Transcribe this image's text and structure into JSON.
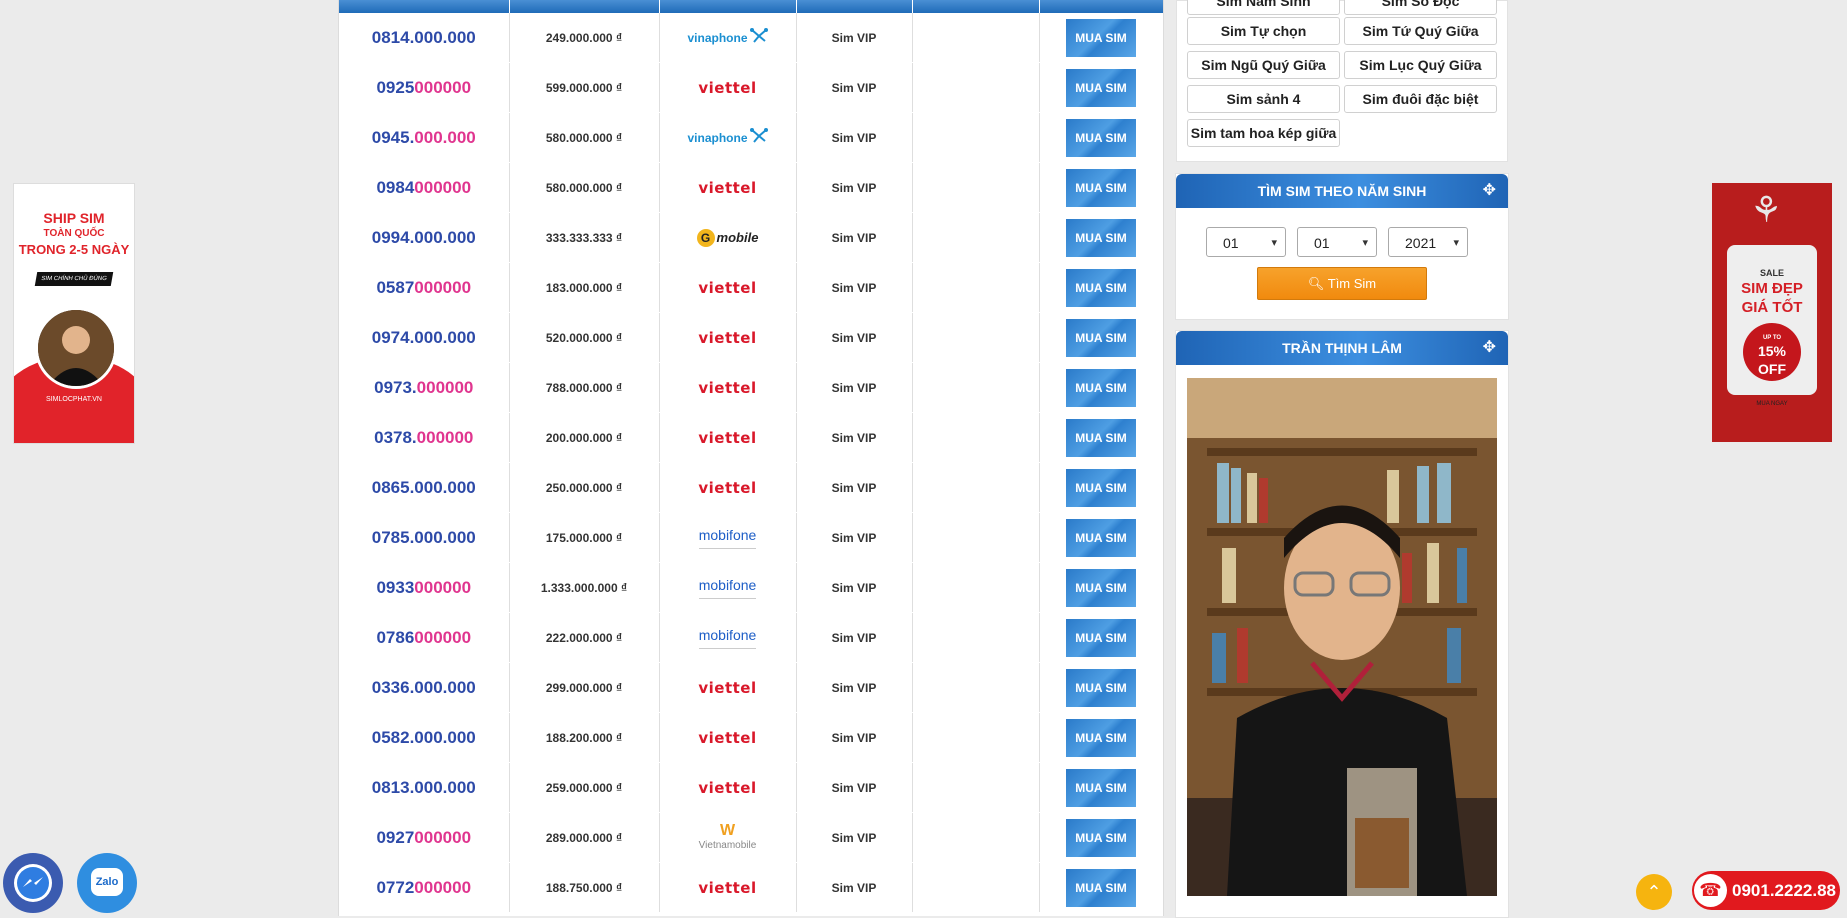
{
  "sims": [
    {
      "num_head": "0814.000.000",
      "num_tail": "",
      "price": "249.000.000 ₫",
      "network": "vinaphone",
      "type": "Sim VIP",
      "buy": "MUA SIM"
    },
    {
      "num_head": "0925",
      "num_tail": "000000",
      "price": "599.000.000 ₫",
      "network": "viettel",
      "type": "Sim VIP",
      "buy": "MUA SIM"
    },
    {
      "num_head": "0945.",
      "num_tail": "000.000",
      "price": "580.000.000 ₫",
      "network": "vinaphone",
      "type": "Sim VIP",
      "buy": "MUA SIM"
    },
    {
      "num_head": "0984",
      "num_tail": "000000",
      "price": "580.000.000 ₫",
      "network": "viettel",
      "type": "Sim VIP",
      "buy": "MUA SIM"
    },
    {
      "num_head": "0994.000.000",
      "num_tail": "",
      "price": "333.333.333 ₫",
      "network": "gmobile",
      "type": "Sim VIP",
      "buy": "MUA SIM"
    },
    {
      "num_head": "0587",
      "num_tail": "000000",
      "price": "183.000.000 ₫",
      "network": "viettel",
      "type": "Sim VIP",
      "buy": "MUA SIM"
    },
    {
      "num_head": "0974.000.000",
      "num_tail": "",
      "price": "520.000.000 ₫",
      "network": "viettel",
      "type": "Sim VIP",
      "buy": "MUA SIM"
    },
    {
      "num_head": "0973.",
      "num_tail": "000000",
      "price": "788.000.000 ₫",
      "network": "viettel",
      "type": "Sim VIP",
      "buy": "MUA SIM"
    },
    {
      "num_head": "0378.",
      "num_tail": "000000",
      "price": "200.000.000 ₫",
      "network": "viettel",
      "type": "Sim VIP",
      "buy": "MUA SIM"
    },
    {
      "num_head": "0865.000.000",
      "num_tail": "",
      "price": "250.000.000 ₫",
      "network": "viettel",
      "type": "Sim VIP",
      "buy": "MUA SIM"
    },
    {
      "num_head": "0785.000.000",
      "num_tail": "",
      "price": "175.000.000 ₫",
      "network": "mobifone",
      "type": "Sim VIP",
      "buy": "MUA SIM"
    },
    {
      "num_head": "0933",
      "num_tail": "000000",
      "price": "1.333.000.000 ₫",
      "network": "mobifone",
      "type": "Sim VIP",
      "buy": "MUA SIM"
    },
    {
      "num_head": "0786",
      "num_tail": "000000",
      "price": "222.000.000 ₫",
      "network": "mobifone",
      "type": "Sim VIP",
      "buy": "MUA SIM"
    },
    {
      "num_head": "0336.000.000",
      "num_tail": "",
      "price": "299.000.000 ₫",
      "network": "viettel",
      "type": "Sim VIP",
      "buy": "MUA SIM"
    },
    {
      "num_head": "0582.000.000",
      "num_tail": "",
      "price": "188.200.000 ₫",
      "network": "viettel",
      "type": "Sim VIP",
      "buy": "MUA SIM"
    },
    {
      "num_head": "0813.000.000",
      "num_tail": "",
      "price": "259.000.000 ₫",
      "network": "viettel",
      "type": "Sim VIP",
      "buy": "MUA SIM"
    },
    {
      "num_head": "0927",
      "num_tail": "000000",
      "price": "289.000.000 ₫",
      "network": "vietnamobile",
      "type": "Sim VIP",
      "buy": "MUA SIM"
    },
    {
      "num_head": "0772",
      "num_tail": "000000",
      "price": "188.750.000 ₫",
      "network": "viettel",
      "type": "Sim VIP",
      "buy": "MUA SIM"
    }
  ],
  "network_labels": {
    "vinaphone": "vinaphone",
    "viettel": "viettel",
    "mobifone": "mobifone",
    "gmobile": "mobile",
    "gmobile_g": "G",
    "vietnamobile": "Vietnamobile",
    "vietnamobile_w": "W"
  },
  "sim_types": {
    "partial_top": [
      "Sim Năm Sinh",
      "Sim Số Độc"
    ],
    "items": [
      "Sim Tự chọn",
      "Sim Tứ Quý Giữa",
      "Sim Ngũ Quý Giữa",
      "Sim Lục Quý Giữa",
      "Sim sảnh 4",
      "Sim đuôi đặc biệt",
      "Sim tam hoa kép giữa"
    ]
  },
  "birth_search": {
    "title": "TÌM SIM THEO NĂM SINH",
    "day": "01",
    "month": "01",
    "year": "2021",
    "button": "Tìm Sim"
  },
  "person_panel": {
    "title": "TRẦN THỊNH LÂM"
  },
  "banner_left": {
    "line1": "SHIP SIM",
    "line2": "TOÀN QUỐC",
    "line3": "TRONG 2-5 NGÀY",
    "ribbon": "SIM CHÍNH CHỦ ĐÚNG NGÀY",
    "site": "SIMLOCPHAT.VN"
  },
  "banner_right": {
    "sale": "SALE",
    "line1": "SIM ĐẸP",
    "line2": "GIÁ TỐT",
    "off_value": "15%",
    "off_label": "OFF",
    "upto": "UP TO",
    "footer": "MUA NGAY"
  },
  "floating": {
    "zalo": "Zalo",
    "hotline": "0901.2222.88"
  },
  "colors": {
    "accent_blue": "#1f6bb8",
    "number_blue": "#2d4aa8",
    "number_pink": "#e0358f",
    "orange_button": "#f18a0e",
    "hotline_red": "#e1191e"
  }
}
